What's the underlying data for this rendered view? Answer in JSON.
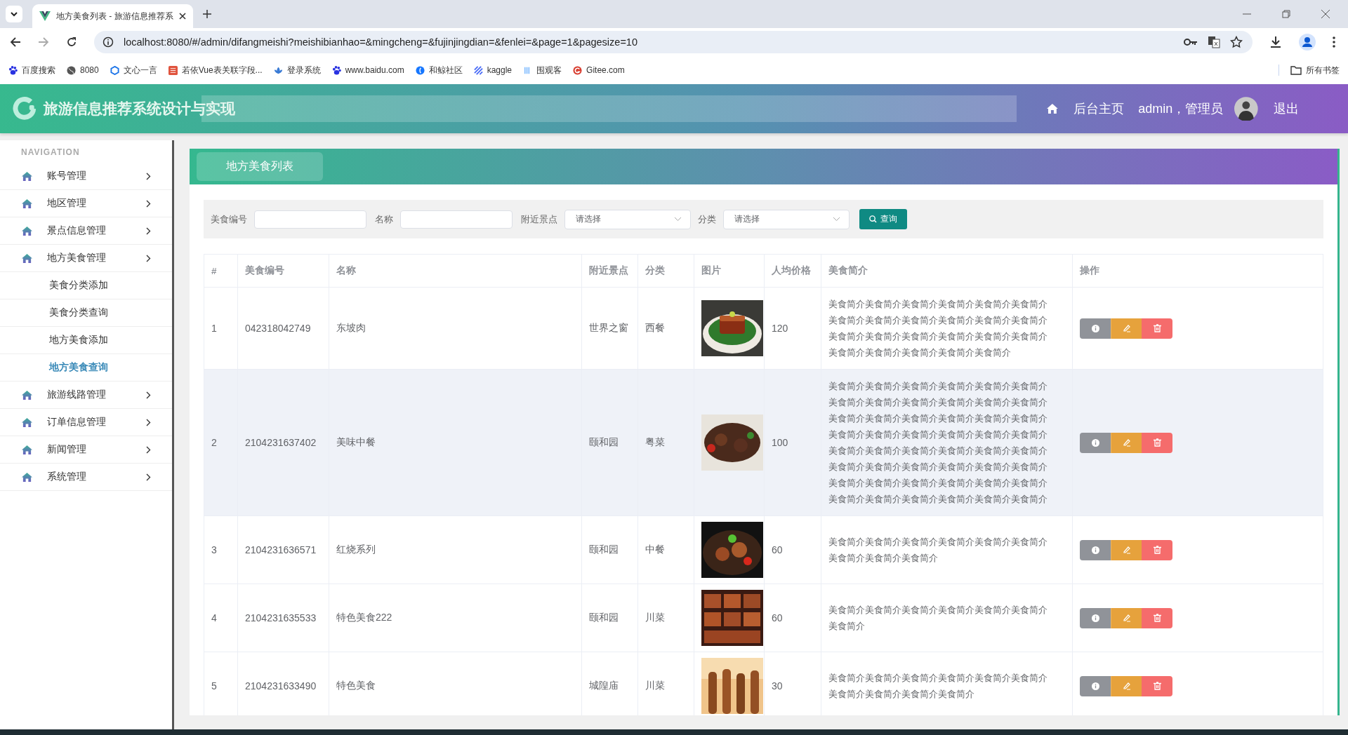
{
  "browser": {
    "tab_title": "地方美食列表 - 旅游信息推荐系",
    "url": "localhost:8080/#/admin/difangmeishi?meishibianhao=&mingcheng=&fujinjingdian=&fenlei=&page=1&pagesize=10",
    "bookmarks": [
      {
        "label": "百度搜索",
        "kind": "paw"
      },
      {
        "label": "8080",
        "kind": "globe"
      },
      {
        "label": "文心一言",
        "kind": "cube"
      },
      {
        "label": "若依Vue表关联字段...",
        "kind": "square"
      },
      {
        "label": "登录系统",
        "kind": "leaf"
      },
      {
        "label": "www.baidu.com",
        "kind": "paw"
      },
      {
        "label": "和鲸社区",
        "kind": "drop"
      },
      {
        "label": "kaggle",
        "kind": "stripes"
      },
      {
        "label": "围观客",
        "kind": "bars"
      },
      {
        "label": "Gitee.com",
        "kind": "ring"
      }
    ],
    "all_bookmarks": "所有书签"
  },
  "header": {
    "title": "旅游信息推荐系统设计与实现",
    "home": "后台主页",
    "user": "admin，管理员",
    "logout": "退出"
  },
  "sidebar": {
    "heading": "NAVIGATION",
    "items": [
      {
        "label": "账号管理"
      },
      {
        "label": "地区管理"
      },
      {
        "label": "景点信息管理"
      },
      {
        "label": "地方美食管理",
        "children": [
          {
            "label": "美食分类添加",
            "selected": false
          },
          {
            "label": "美食分类查询",
            "selected": false
          },
          {
            "label": "地方美食添加",
            "selected": false
          },
          {
            "label": "地方美食查询",
            "selected": true
          }
        ]
      },
      {
        "label": "旅游线路管理"
      },
      {
        "label": "订单信息管理"
      },
      {
        "label": "新闻管理"
      },
      {
        "label": "系统管理"
      }
    ]
  },
  "panel": {
    "tab": "地方美食列表"
  },
  "search": {
    "fields": [
      {
        "label": "美食编号",
        "kind": "text"
      },
      {
        "label": "名称",
        "kind": "text"
      },
      {
        "label": "附近景点",
        "kind": "select",
        "placeholder": "请选择"
      },
      {
        "label": "分类",
        "kind": "select",
        "placeholder": "请选择"
      }
    ],
    "button": "查询"
  },
  "table": {
    "columns": [
      "#",
      "美食编号",
      "名称",
      "附近景点",
      "分类",
      "图片",
      "人均价格",
      "美食简介",
      "操作"
    ],
    "rows": [
      {
        "index": "1",
        "code": "042318042749",
        "name": "东坡肉",
        "spot": "世界之窗",
        "category": "西餐",
        "price": "120",
        "intro": "美食简介美食简介美食简介美食简介美食简介美食简介美食简介美食简介美食简介美食简介美食简介美食简介美食简介美食简介美食简介美食简介美食简介美食简介美食简介美食简介美食简介美食简介美食简介",
        "hovered": false
      },
      {
        "index": "2",
        "code": "2104231637402",
        "name": "美味中餐",
        "spot": "颐和园",
        "category": "粤菜",
        "price": "100",
        "intro": "美食简介美食简介美食简介美食简介美食简介美食简介美食简介美食简介美食简介美食简介美食简介美食简介美食简介美食简介美食简介美食简介美食简介美食简介美食简介美食简介美食简介美食简介美食简介美食简介美食简介美食简介美食简介美食简介美食简介美食简介美食简介美食简介美食简介美食简介美食简介美食简介美食简介美食简介美食简介美食简介美食简介美食简介美食简介美食简介美食简介美食简介美食简介美食简介",
        "hovered": true
      },
      {
        "index": "3",
        "code": "2104231636571",
        "name": "红烧系列",
        "spot": "颐和园",
        "category": "中餐",
        "price": "60",
        "intro": "美食简介美食简介美食简介美食简介美食简介美食简介美食简介美食简介美食简介",
        "hovered": false
      },
      {
        "index": "4",
        "code": "2104231635533",
        "name": "特色美食222",
        "spot": "颐和园",
        "category": "川菜",
        "price": "60",
        "intro": "美食简介美食简介美食简介美食简介美食简介美食简介美食简介",
        "hovered": false
      },
      {
        "index": "5",
        "code": "2104231633490",
        "name": "特色美食",
        "spot": "城隍庙",
        "category": "川菜",
        "price": "30",
        "intro": "美食简介美食简介美食简介美食简介美食简介美食简介美食简介美食简介美食简介美食简介",
        "hovered": false
      }
    ]
  }
}
